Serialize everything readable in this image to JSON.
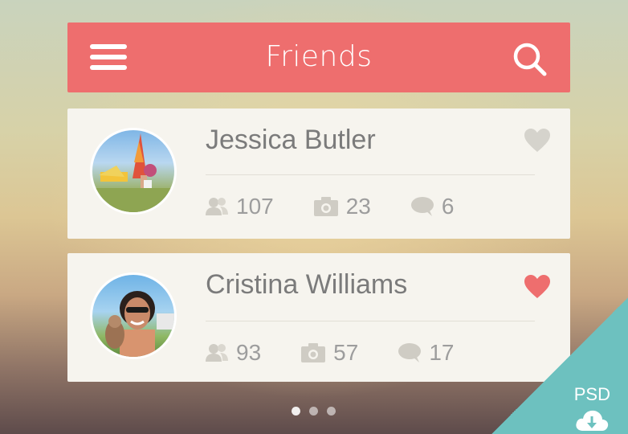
{
  "header": {
    "title": "Friends",
    "menu_icon": "hamburger-menu-icon",
    "search_icon": "search-icon",
    "color": "#ee6e6e"
  },
  "friends": [
    {
      "name": "Jessica Butler",
      "liked": false,
      "stats": {
        "friends": "107",
        "photos": "23",
        "comments": "6"
      }
    },
    {
      "name": "Cristina Williams",
      "liked": true,
      "stats": {
        "friends": "93",
        "photos": "57",
        "comments": "17"
      }
    }
  ],
  "pagination": {
    "pages": 3,
    "active": 1
  },
  "badge": {
    "label": "PSD",
    "icon": "cloud-download-icon",
    "color": "#6dc1bf"
  },
  "colors": {
    "heart_active": "#ee6e6e",
    "heart_inactive": "#d5d3cc"
  }
}
